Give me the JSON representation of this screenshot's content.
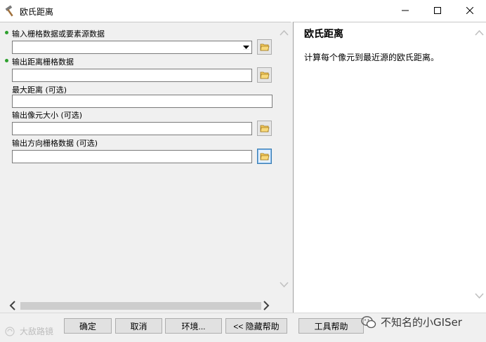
{
  "window": {
    "title": "欧氏距离",
    "icon": "hammer-icon",
    "controls": [
      "minimize-icon",
      "maximize-icon",
      "close-icon"
    ]
  },
  "params": [
    {
      "label": "输入栅格数据或要素源数据",
      "required": true,
      "value": "",
      "type": "combo"
    },
    {
      "label": "输出距离栅格数据",
      "required": true,
      "value": "",
      "type": "text"
    },
    {
      "label": "最大距离 (可选)",
      "required": false,
      "value": "",
      "type": "text"
    },
    {
      "label": "输出像元大小 (可选)",
      "required": false,
      "value": "",
      "type": "text"
    },
    {
      "label": "输出方向栅格数据 (可选)",
      "required": false,
      "value": "",
      "type": "text"
    }
  ],
  "help": {
    "title": "欧氏距离",
    "body": "计算每个像元到最近源的欧氏距离。"
  },
  "buttons": {
    "ok": "确定",
    "cancel": "取消",
    "environments": "环境...",
    "hide_help": "<< 隐藏帮助",
    "tool_help": "工具帮助"
  },
  "watermarks": {
    "left": "大敌路镜",
    "right": "不知名的小GISer"
  },
  "colors": {
    "required_dot": "#2da02d",
    "panel_bg": "#f0f0f0",
    "focus_border": "#3c7fb1"
  }
}
